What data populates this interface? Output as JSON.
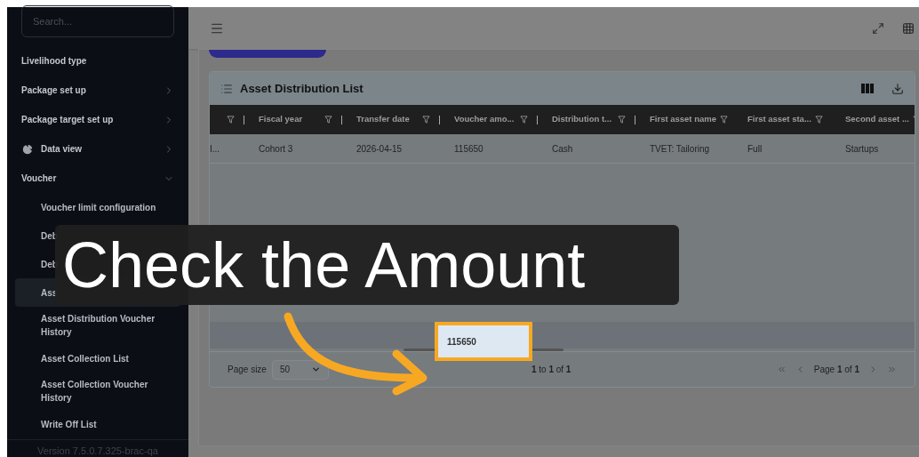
{
  "sidebar": {
    "search": {
      "placeholder": "Search..."
    },
    "items": [
      {
        "label": "Livelihood type",
        "kind": "plain"
      },
      {
        "label": "Package set up",
        "kind": "submenu",
        "expanded": false
      },
      {
        "label": "Package target set up",
        "kind": "submenu",
        "expanded": false
      },
      {
        "label": "Data view",
        "kind": "icon-submenu",
        "expanded": false
      },
      {
        "label": "Voucher",
        "kind": "submenu",
        "expanded": true,
        "children": [
          {
            "label": "Voucher limit configuration",
            "selected": false
          },
          {
            "label": "Deb",
            "selected": false
          },
          {
            "label": "Deb",
            "selected": false
          },
          {
            "label": "Ass",
            "selected": true
          },
          {
            "label": "Asset Distribution Voucher History",
            "selected": false
          },
          {
            "label": "Asset Collection List",
            "selected": false
          },
          {
            "label": "Asset Collection Voucher History",
            "selected": false
          },
          {
            "label": "Write Off List",
            "selected": false
          }
        ]
      }
    ],
    "version": "Version 7.5.0.7.325-brac-qa"
  },
  "table": {
    "title": "Asset Distribution List",
    "columns": [
      "",
      "Fiscal year",
      "Transfer date",
      "Voucher amo...",
      "Distribution t...",
      "First asset name",
      "First asset sta...",
      "Second asset ..."
    ],
    "rows": [
      {
        "cells": [
          "I...",
          "Cohort 3",
          "2026-04-15",
          "115650",
          "Cash",
          "TVET: Tailoring",
          "Full",
          "Startups"
        ]
      }
    ],
    "total": {
      "value": "115650",
      "highlighted": true
    },
    "pagination": {
      "page_size_label": "Page size",
      "page_size": "50",
      "summary": "**1** to **1** of **1**",
      "page": "Page **1** of **1**"
    }
  },
  "callout": {
    "text": "Check the Amount"
  }
}
